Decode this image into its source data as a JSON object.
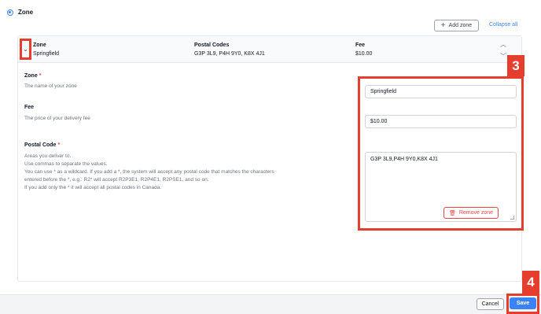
{
  "zone_option": {
    "label": "Zone"
  },
  "toolbar": {
    "add_zone_label": "Add zone",
    "collapse_all_label": "Collapse all"
  },
  "header": {
    "columns": [
      {
        "title": "Zone",
        "value": "Springfield"
      },
      {
        "title": "Postal Codes",
        "value": "G3P 3L9, P4H 9Y0, K8X 4J1"
      },
      {
        "title": "Fee",
        "value": "$10.00"
      }
    ]
  },
  "form": {
    "zone": {
      "label": "Zone",
      "required_mark": "*",
      "help": "The name of your zone",
      "value": "Springfield"
    },
    "fee": {
      "label": "Fee",
      "help": "The price of your delivery fee",
      "value": "$10.00"
    },
    "postal_code": {
      "label": "Postal Code",
      "required_mark": "*",
      "help_lines": [
        "Areas you deliver to.",
        "Use commas to separate the values.",
        "You can use * as a wildcard. If you add a *, the system will accept any postal code that matches the characters",
        "entered before the *, e.g.: R2* will accept R2P3E1, R2P4E1, R2PSE1, and so on.",
        "If you add only the * it will accept all postal codes in Canada."
      ],
      "value": "G3P 3L9,P4H 9Y0,K8X 4J1"
    },
    "remove_label": "Remove zone"
  },
  "annotations": {
    "badge_3": "3",
    "badge_4": "4",
    "highlight_color": "#e53e2e"
  },
  "footer": {
    "cancel_label": "Cancel",
    "save_label": "Save"
  },
  "colors": {
    "accent": "#3b82f6",
    "danger": "#ef4444"
  }
}
